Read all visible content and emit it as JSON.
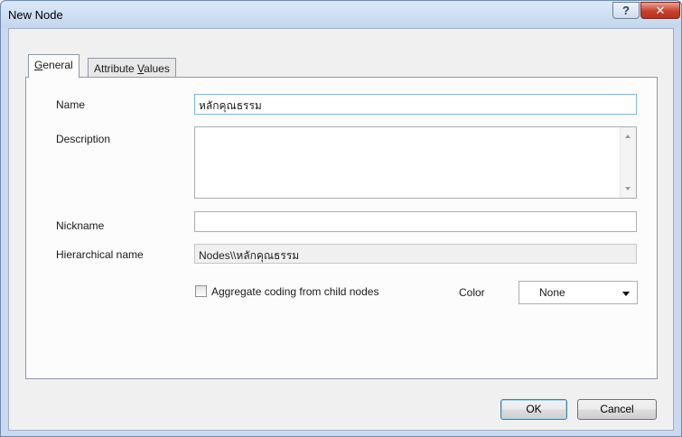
{
  "window": {
    "title": "New Node",
    "help_glyph": "?",
    "close_glyph": "✕"
  },
  "tabs": [
    {
      "label_prefix": "",
      "label_mnemonic": "G",
      "label_rest": "eneral",
      "selected": true
    },
    {
      "label_prefix": "Attribute ",
      "label_mnemonic": "V",
      "label_rest": "alues",
      "selected": false
    }
  ],
  "form": {
    "name_label": "Name",
    "name_value": "หลักคุณธรรม",
    "description_label": "Description",
    "description_value": "",
    "nickname_label": "Nickname",
    "nickname_value": "",
    "hierarchical_label": "Hierarchical name",
    "hierarchical_value": "Nodes\\\\หลักคุณธรรม",
    "aggregate_label": "Aggregate coding from child nodes",
    "aggregate_checked": false,
    "color_label": "Color",
    "color_value": "None"
  },
  "buttons": {
    "ok": "OK",
    "cancel": "Cancel"
  },
  "colors": {
    "frame": "#c9daf0",
    "close_button": "#c6402a",
    "focus_border": "#7eb4ea"
  }
}
